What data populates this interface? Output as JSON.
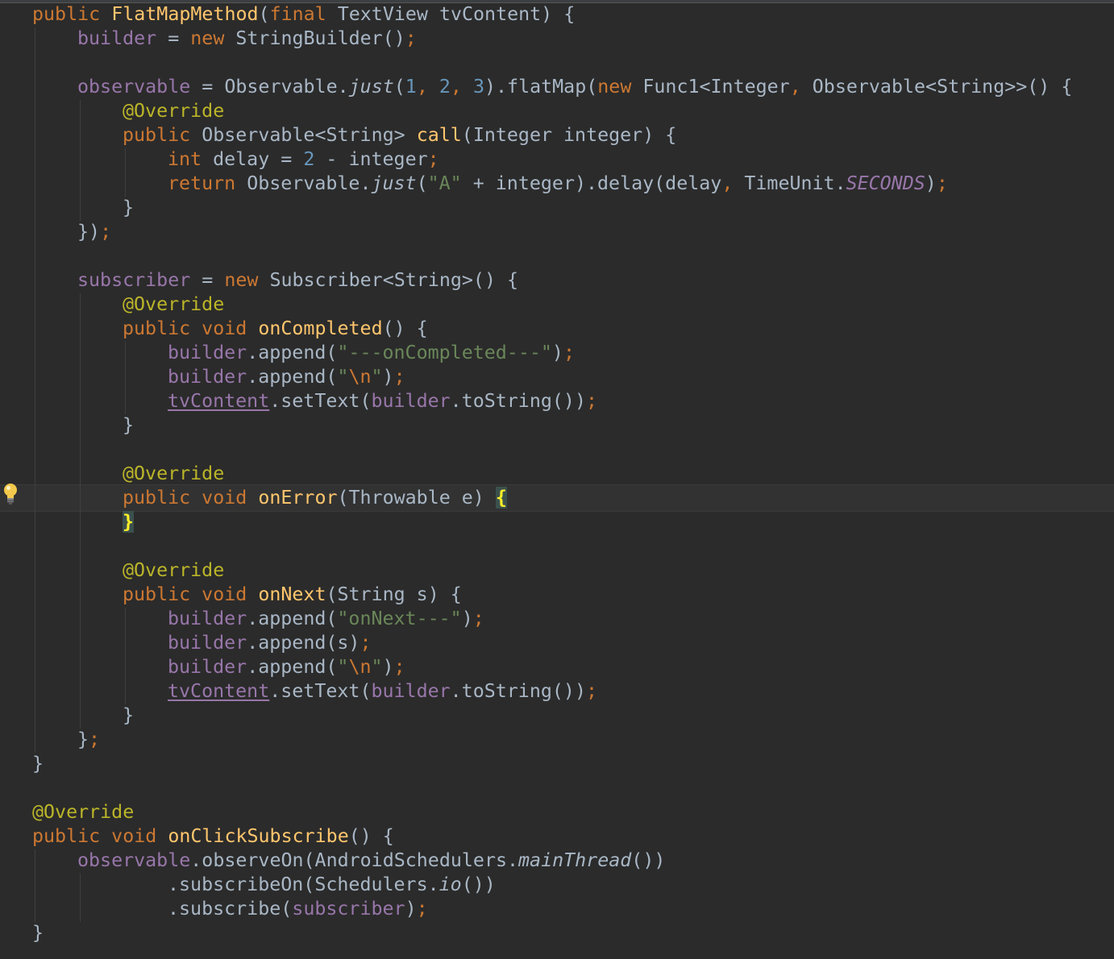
{
  "editor": {
    "theme": "Darcula",
    "background": "#2b2b2b",
    "colors": {
      "default": "#a9b7c6",
      "keyword": "#cc7832",
      "method": "#ffc66d",
      "field": "#9876aa",
      "number": "#6897bb",
      "string": "#6a8759",
      "annotation": "#bbb529",
      "brace_match": "#ffef28"
    },
    "gutter_icon": "lightbulb-icon",
    "lines": [
      {
        "indent": 0,
        "tokens": [
          [
            "kw",
            "public "
          ],
          [
            "method",
            "FlatMapMethod"
          ],
          [
            "default",
            "("
          ],
          [
            "kw",
            "final "
          ],
          [
            "default",
            "TextView tvContent) {"
          ]
        ]
      },
      {
        "indent": 4,
        "tokens": [
          [
            "field",
            "builder"
          ],
          [
            "default",
            " = "
          ],
          [
            "kw",
            "new "
          ],
          [
            "default",
            "StringBuilder()"
          ],
          [
            "kw",
            ";"
          ]
        ]
      },
      {
        "indent": 0,
        "tokens": []
      },
      {
        "indent": 4,
        "tokens": [
          [
            "field",
            "observable"
          ],
          [
            "default",
            " = Observable."
          ],
          [
            "italic",
            "just"
          ],
          [
            "default",
            "("
          ],
          [
            "num",
            "1"
          ],
          [
            "kw",
            ", "
          ],
          [
            "num",
            "2"
          ],
          [
            "kw",
            ", "
          ],
          [
            "num",
            "3"
          ],
          [
            "default",
            ").flatMap("
          ],
          [
            "kw",
            "new "
          ],
          [
            "default",
            "Func1<Integer"
          ],
          [
            "kw",
            ", "
          ],
          [
            "default",
            "Observable<String>>() {"
          ]
        ]
      },
      {
        "indent": 8,
        "tokens": [
          [
            "annotation",
            "@Override"
          ]
        ]
      },
      {
        "indent": 8,
        "tokens": [
          [
            "kw",
            "public "
          ],
          [
            "default",
            "Observable<String> "
          ],
          [
            "method",
            "call"
          ],
          [
            "default",
            "(Integer integer) {"
          ]
        ]
      },
      {
        "indent": 12,
        "tokens": [
          [
            "kw",
            "int "
          ],
          [
            "default",
            "delay = "
          ],
          [
            "num",
            "2 "
          ],
          [
            "default",
            "- integer"
          ],
          [
            "kw",
            ";"
          ]
        ]
      },
      {
        "indent": 12,
        "tokens": [
          [
            "kw",
            "return "
          ],
          [
            "default",
            "Observable."
          ],
          [
            "italic",
            "just"
          ],
          [
            "default",
            "("
          ],
          [
            "str",
            "\"A\" "
          ],
          [
            "default",
            "+ integer).delay(delay"
          ],
          [
            "kw",
            ", "
          ],
          [
            "default",
            "TimeUnit."
          ],
          [
            "staticfield",
            "SECONDS"
          ],
          [
            "default",
            ")"
          ],
          [
            "kw",
            ";"
          ]
        ]
      },
      {
        "indent": 8,
        "tokens": [
          [
            "default",
            "}"
          ]
        ]
      },
      {
        "indent": 4,
        "tokens": [
          [
            "default",
            "})"
          ],
          [
            "kw",
            ";"
          ]
        ]
      },
      {
        "indent": 0,
        "tokens": []
      },
      {
        "indent": 4,
        "tokens": [
          [
            "field",
            "subscriber"
          ],
          [
            "default",
            " = "
          ],
          [
            "kw",
            "new "
          ],
          [
            "default",
            "Subscriber<String>() {"
          ]
        ]
      },
      {
        "indent": 8,
        "tokens": [
          [
            "annotation",
            "@Override"
          ]
        ]
      },
      {
        "indent": 8,
        "tokens": [
          [
            "kw",
            "public void "
          ],
          [
            "method",
            "onCompleted"
          ],
          [
            "default",
            "() {"
          ]
        ]
      },
      {
        "indent": 12,
        "tokens": [
          [
            "field",
            "builder"
          ],
          [
            "default",
            ".append("
          ],
          [
            "str",
            "\"---onCompleted---\""
          ],
          [
            "default",
            ")"
          ],
          [
            "kw",
            ";"
          ]
        ]
      },
      {
        "indent": 12,
        "tokens": [
          [
            "field",
            "builder"
          ],
          [
            "default",
            ".append("
          ],
          [
            "str",
            "\""
          ],
          [
            "escape",
            "\\n"
          ],
          [
            "str",
            "\""
          ],
          [
            "default",
            ")"
          ],
          [
            "kw",
            ";"
          ]
        ]
      },
      {
        "indent": 12,
        "tokens": [
          [
            "underline",
            "tvContent"
          ],
          [
            "default",
            ".setText("
          ],
          [
            "field",
            "builder"
          ],
          [
            "default",
            ".toString())"
          ],
          [
            "kw",
            ";"
          ]
        ]
      },
      {
        "indent": 8,
        "tokens": [
          [
            "default",
            "}"
          ]
        ]
      },
      {
        "indent": 0,
        "tokens": []
      },
      {
        "indent": 8,
        "tokens": [
          [
            "annotation",
            "@Override"
          ]
        ]
      },
      {
        "indent": 8,
        "tokens": [
          [
            "kw",
            "public void "
          ],
          [
            "method",
            "onError"
          ],
          [
            "default",
            "(Throwable e) "
          ],
          [
            "bracematch",
            "{"
          ]
        ]
      },
      {
        "indent": 8,
        "tokens": [
          [
            "bracematch",
            "}"
          ]
        ]
      },
      {
        "indent": 0,
        "tokens": []
      },
      {
        "indent": 8,
        "tokens": [
          [
            "annotation",
            "@Override"
          ]
        ]
      },
      {
        "indent": 8,
        "tokens": [
          [
            "kw",
            "public void "
          ],
          [
            "method",
            "onNext"
          ],
          [
            "default",
            "(String s) {"
          ]
        ]
      },
      {
        "indent": 12,
        "tokens": [
          [
            "field",
            "builder"
          ],
          [
            "default",
            ".append("
          ],
          [
            "str",
            "\"onNext---\""
          ],
          [
            "default",
            ")"
          ],
          [
            "kw",
            ";"
          ]
        ]
      },
      {
        "indent": 12,
        "tokens": [
          [
            "field",
            "builder"
          ],
          [
            "default",
            ".append(s)"
          ],
          [
            "kw",
            ";"
          ]
        ]
      },
      {
        "indent": 12,
        "tokens": [
          [
            "field",
            "builder"
          ],
          [
            "default",
            ".append("
          ],
          [
            "str",
            "\""
          ],
          [
            "escape",
            "\\n"
          ],
          [
            "str",
            "\""
          ],
          [
            "default",
            ")"
          ],
          [
            "kw",
            ";"
          ]
        ]
      },
      {
        "indent": 12,
        "tokens": [
          [
            "underline",
            "tvContent"
          ],
          [
            "default",
            ".setText("
          ],
          [
            "field",
            "builder"
          ],
          [
            "default",
            ".toString())"
          ],
          [
            "kw",
            ";"
          ]
        ]
      },
      {
        "indent": 8,
        "tokens": [
          [
            "default",
            "}"
          ]
        ]
      },
      {
        "indent": 4,
        "tokens": [
          [
            "default",
            "}"
          ],
          [
            "kw",
            ";"
          ]
        ]
      },
      {
        "indent": 0,
        "tokens": [
          [
            "default",
            "}"
          ]
        ]
      },
      {
        "indent": 0,
        "tokens": []
      },
      {
        "indent": 0,
        "tokens": [
          [
            "annotation",
            "@Override"
          ]
        ]
      },
      {
        "indent": 0,
        "tokens": [
          [
            "kw",
            "public void "
          ],
          [
            "method",
            "onClickSubscribe"
          ],
          [
            "default",
            "() {"
          ]
        ]
      },
      {
        "indent": 4,
        "tokens": [
          [
            "field",
            "observable"
          ],
          [
            "default",
            ".observeOn(AndroidSchedulers."
          ],
          [
            "italic",
            "mainThread"
          ],
          [
            "default",
            "())"
          ]
        ]
      },
      {
        "indent": 12,
        "tokens": [
          [
            "default",
            ".subscribeOn(Schedulers."
          ],
          [
            "italic",
            "io"
          ],
          [
            "default",
            "())"
          ]
        ]
      },
      {
        "indent": 12,
        "tokens": [
          [
            "default",
            ".subscribe("
          ],
          [
            "field",
            "subscriber"
          ],
          [
            "default",
            ")"
          ],
          [
            "kw",
            ";"
          ]
        ]
      },
      {
        "indent": 0,
        "tokens": [
          [
            "default",
            "}"
          ]
        ]
      }
    ]
  }
}
